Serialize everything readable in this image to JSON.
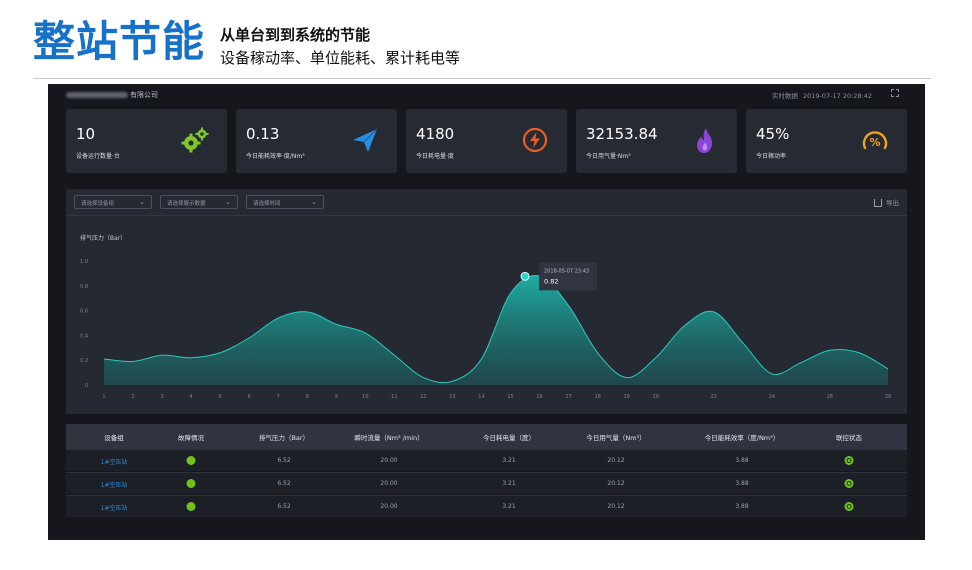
{
  "header": {
    "title": "整站节能",
    "subtitle_line1": "从单台到到系统的节能",
    "subtitle_line2": "设备稼动率、单位能耗、累计耗电等"
  },
  "app": {
    "company_suffix": "有限公司",
    "realtime_label": "实时数据",
    "datetime": "2019-07-17 20:28:42"
  },
  "kpis": [
    {
      "value": "10",
      "label": "设备运行数量·台",
      "icon": "gears-icon",
      "color": "#7ec82a"
    },
    {
      "value": "0.13",
      "label": "今日能耗效率·度/Nm³",
      "icon": "paper-plane-icon",
      "color": "#2a8ee0"
    },
    {
      "value": "4180",
      "label": "今日耗电量·度",
      "icon": "lightning-icon",
      "color": "#e8601d"
    },
    {
      "value": "32153.84",
      "label": "今日用气量·Nm³",
      "icon": "flame-icon",
      "color": "#8a45d8"
    },
    {
      "value": "45%",
      "label": "今日稼动率",
      "icon": "percent-gauge-icon",
      "color": "#f0a51a"
    }
  ],
  "filters": {
    "device_group": "请选择设备组",
    "display_data": "请选择展示数据",
    "time": "请选择时间",
    "export_label": "导出"
  },
  "chart_data": {
    "type": "area",
    "ylabel": "排气压力（Bar）",
    "ylim": [
      0,
      1.0
    ],
    "yticks": [
      "0",
      "0.2",
      "0.4",
      "0.6",
      "0.8",
      "1.0"
    ],
    "x": [
      "1",
      "2",
      "3",
      "4",
      "5",
      "6",
      "7",
      "8",
      "9",
      "10",
      "11",
      "12",
      "13",
      "14",
      "15",
      "16",
      "17",
      "18",
      "19",
      "20",
      "21",
      "22",
      "23",
      "24",
      "25",
      "26",
      "27",
      "28"
    ],
    "xtick_labels": [
      "1",
      "2",
      "3",
      "4",
      "5",
      "6",
      "7",
      "8",
      "9",
      "10",
      "11",
      "12",
      "13",
      "14",
      "15",
      "16",
      "17",
      "18",
      "19",
      "20",
      "22",
      "24",
      "26",
      "28"
    ],
    "values": [
      0.21,
      0.19,
      0.24,
      0.22,
      0.26,
      0.38,
      0.54,
      0.59,
      0.49,
      0.42,
      0.24,
      0.06,
      0.03,
      0.21,
      0.74,
      0.88,
      0.64,
      0.26,
      0.06,
      0.22,
      0.48,
      0.59,
      0.34,
      0.09,
      0.18,
      0.28,
      0.26,
      0.13
    ],
    "tooltip": {
      "date": "2018-05-07 23:43",
      "value": "0.82",
      "x": "15.5"
    },
    "fill_color": "#19a39a"
  },
  "table": {
    "headers": [
      "设备组",
      "故障情况",
      "排气压力（Bar）",
      "瞬时流量（Nm³ /min）",
      "今日耗电量（度）",
      "今日用气量（Nm³）",
      "今日能耗效率（度/Nm³）",
      "联控状态"
    ],
    "rows": [
      {
        "group": "1#空压站",
        "fault": "ok",
        "pressure": "6.52",
        "flow": "20.00",
        "power": "3.21",
        "gas": "20.12",
        "efficiency": "3.88",
        "control": "on"
      },
      {
        "group": "1#空压站",
        "fault": "ok",
        "pressure": "6.52",
        "flow": "20.00",
        "power": "3.21",
        "gas": "20.12",
        "efficiency": "3.88",
        "control": "on"
      },
      {
        "group": "1#空压站",
        "fault": "ok",
        "pressure": "6.52",
        "flow": "20.00",
        "power": "3.21",
        "gas": "20.12",
        "efficiency": "3.88",
        "control": "on"
      }
    ]
  }
}
